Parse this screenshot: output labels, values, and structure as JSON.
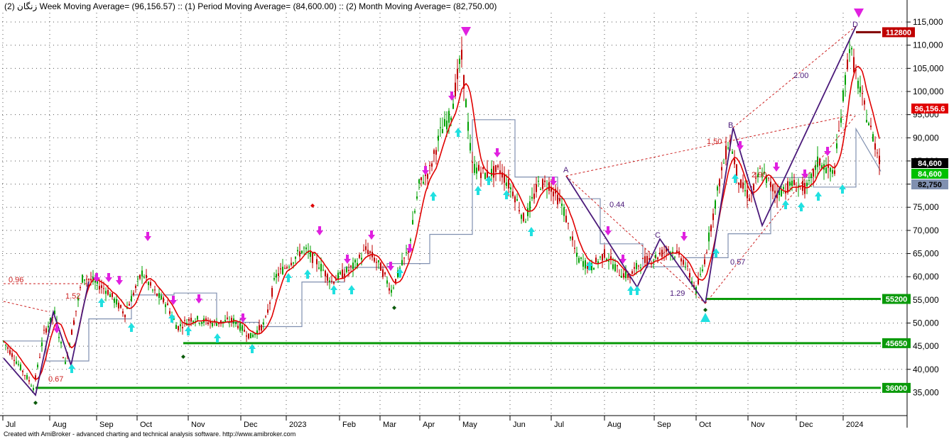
{
  "header": {
    "title": "زنگان (2) Week Moving Average= (96,156.57) :: (1) Period Moving Average= (84,600.00) :: (2) Month Moving Average= (82,750.00)"
  },
  "footer": {
    "credit": "Created with AmiBroker - advanced charting and technical analysis software. http://www.amibroker.com"
  },
  "colors": {
    "bullish_candle": "#00a000",
    "bearish_candle": "#c00000",
    "week_ma": "#e00000",
    "month_ma": "#8090b0",
    "support_line": "#0a9a0a",
    "pattern_line": "#4b1a7a",
    "pattern_dash": "#cc2020",
    "buy_arrow": "#20e0e0",
    "sell_arrow": "#e020e0",
    "grid": "#555555"
  },
  "chart_data": {
    "type": "candlestick",
    "y_axis": {
      "min": 32000,
      "max": 117000,
      "ticks": [
        35000,
        40000,
        45000,
        50000,
        55000,
        60000,
        65000,
        70000,
        75000,
        80000,
        85000,
        90000,
        95000,
        100000,
        105000,
        110000,
        115000
      ],
      "tick_labels": [
        "35,000",
        "40,000",
        "45,000",
        "50,000",
        "55,000",
        "60,000",
        "65,000",
        "70,000",
        "75,000",
        "80,000",
        "85,000",
        "90,000",
        "95,000",
        "100,000",
        "105,000",
        "110,000",
        "115,000"
      ]
    },
    "x_axis": {
      "labels": [
        "Jul",
        "Aug",
        "Sep",
        "Oct",
        "Nov",
        "Dec",
        "2023",
        "Feb",
        "Mar",
        "Apr",
        "May",
        "Jun",
        "Jul",
        "Aug",
        "Sep",
        "Oct",
        "Nov",
        "Dec",
        "2024"
      ]
    },
    "grid": true,
    "series": [
      {
        "name": "(2) Week Moving Average",
        "last": "96,156.57",
        "label": "96,156.6"
      },
      {
        "name": "(1) Period Moving Average",
        "last": "84,600.00",
        "label": "84,600"
      },
      {
        "name": "(2) Month Moving Average",
        "last": "82,750.00",
        "label": "82,750"
      }
    ],
    "price_anchors": [
      [
        0,
        46500
      ],
      [
        0.045,
        36000
      ],
      [
        0.06,
        48000
      ],
      [
        0.075,
        52000
      ],
      [
        0.09,
        41000
      ],
      [
        0.115,
        60000
      ],
      [
        0.13,
        59000
      ],
      [
        0.15,
        57000
      ],
      [
        0.175,
        52000
      ],
      [
        0.2,
        61000
      ],
      [
        0.215,
        57000
      ],
      [
        0.235,
        54000
      ],
      [
        0.25,
        49000
      ],
      [
        0.27,
        51000
      ],
      [
        0.3,
        50000
      ],
      [
        0.33,
        50500
      ],
      [
        0.355,
        47000
      ],
      [
        0.375,
        50000
      ],
      [
        0.39,
        60000
      ],
      [
        0.41,
        63000
      ],
      [
        0.43,
        66000
      ],
      [
        0.45,
        63000
      ],
      [
        0.47,
        59000
      ],
      [
        0.5,
        62000
      ],
      [
        0.52,
        66000
      ],
      [
        0.54,
        62000
      ],
      [
        0.555,
        57000
      ],
      [
        0.58,
        66000
      ],
      [
        0.595,
        80000
      ],
      [
        0.61,
        83000
      ],
      [
        0.625,
        91000
      ],
      [
        0.64,
        95000
      ],
      [
        0.655,
        108000
      ],
      [
        0.67,
        84000
      ],
      [
        0.69,
        82000
      ],
      [
        0.71,
        83000
      ],
      [
        0.73,
        78000
      ],
      [
        0.745,
        72000
      ],
      [
        0.765,
        80000
      ],
      [
        0.78,
        80000
      ],
      [
        0.8,
        75000
      ],
      [
        0.82,
        64000
      ],
      [
        0.84,
        62000
      ],
      [
        0.86,
        65000
      ],
      [
        0.88,
        61000
      ],
      [
        0.895,
        60000
      ],
      [
        0.91,
        63000
      ],
      [
        0.93,
        64000
      ],
      [
        0.95,
        66000
      ],
      [
        0.97,
        64000
      ],
      [
        0.99,
        57000
      ],
      [
        1.0,
        62000
      ]
    ],
    "price_anchors_2": [
      [
        0.0,
        62000
      ],
      [
        0.03,
        80000
      ],
      [
        0.05,
        90000
      ],
      [
        0.07,
        80000
      ],
      [
        0.09,
        77000
      ],
      [
        0.11,
        83000
      ],
      [
        0.14,
        78000
      ],
      [
        0.17,
        80000
      ],
      [
        0.2,
        79000
      ],
      [
        0.22,
        85000
      ],
      [
        0.25,
        82000
      ],
      [
        0.28,
        110000
      ],
      [
        0.3,
        100000
      ],
      [
        0.32,
        92000
      ],
      [
        0.34,
        84600
      ]
    ],
    "support_levels": [
      {
        "value": 55200,
        "label": "55200"
      },
      {
        "value": 45650,
        "label": "45650"
      },
      {
        "value": 36000,
        "label": "36000"
      }
    ],
    "top_level": {
      "value": 112800,
      "label": "112800"
    },
    "last_price": {
      "value": 84600,
      "label": "84,600"
    },
    "pattern_labels": [
      "A",
      "B",
      "C",
      "D",
      "0.96",
      "1.52",
      "0.67",
      "0.44",
      "1.29",
      "1.50",
      "2.00",
      "2.90",
      "0.57"
    ],
    "legend_placement": "top-left"
  }
}
